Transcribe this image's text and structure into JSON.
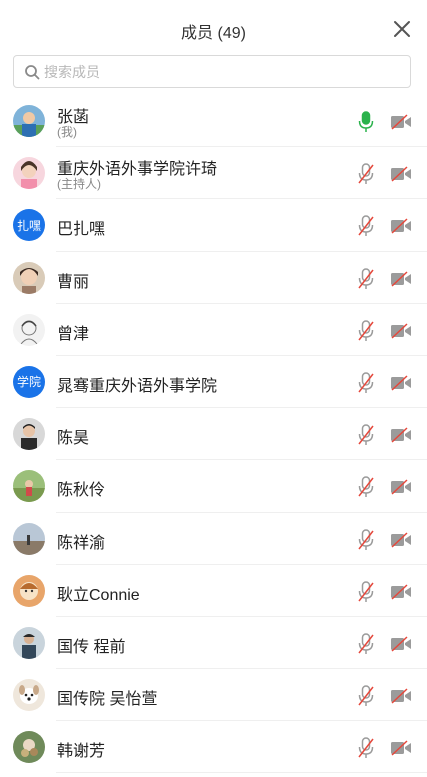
{
  "header": {
    "title": "成员 (49)"
  },
  "search": {
    "placeholder": "搜索成员",
    "value": ""
  },
  "members": [
    {
      "name": "张菡",
      "sub": "(我)",
      "avatar": "photo-boy",
      "avatar_text": "",
      "mic": "on"
    },
    {
      "name": "重庆外语外事学院许琦",
      "sub": "(主持人)",
      "avatar": "photo-girl-pink",
      "avatar_text": "",
      "mic": "off"
    },
    {
      "name": "巴扎嘿",
      "sub": "",
      "avatar": "text",
      "avatar_text": "扎嘿",
      "mic": "off"
    },
    {
      "name": "曹丽",
      "sub": "",
      "avatar": "photo-child",
      "avatar_text": "",
      "mic": "off"
    },
    {
      "name": "曾津",
      "sub": "",
      "avatar": "photo-sketch",
      "avatar_text": "",
      "mic": "off"
    },
    {
      "name": "晁骞重庆外语外事学院",
      "sub": "",
      "avatar": "text",
      "avatar_text": "学院",
      "mic": "off"
    },
    {
      "name": "陈昊",
      "sub": "",
      "avatar": "photo-man",
      "avatar_text": "",
      "mic": "off"
    },
    {
      "name": "陈秋伶",
      "sub": "",
      "avatar": "photo-field",
      "avatar_text": "",
      "mic": "off"
    },
    {
      "name": "陈祥渝",
      "sub": "",
      "avatar": "photo-landscape",
      "avatar_text": "",
      "mic": "off"
    },
    {
      "name": "耿立Connie",
      "sub": "",
      "avatar": "photo-cartoon",
      "avatar_text": "",
      "mic": "off"
    },
    {
      "name": "国传 程前",
      "sub": "",
      "avatar": "photo-person",
      "avatar_text": "",
      "mic": "off"
    },
    {
      "name": "国传院 吴怡萱",
      "sub": "",
      "avatar": "photo-dog",
      "avatar_text": "",
      "mic": "off"
    },
    {
      "name": "韩谢芳",
      "sub": "",
      "avatar": "photo-flower",
      "avatar_text": "",
      "mic": "off"
    }
  ],
  "colors": {
    "mic_on": "#2bb24c",
    "muted_slash": "#e5483c",
    "icon_gray": "#9b9b9b",
    "avatar_blue": "#1a73e8"
  }
}
